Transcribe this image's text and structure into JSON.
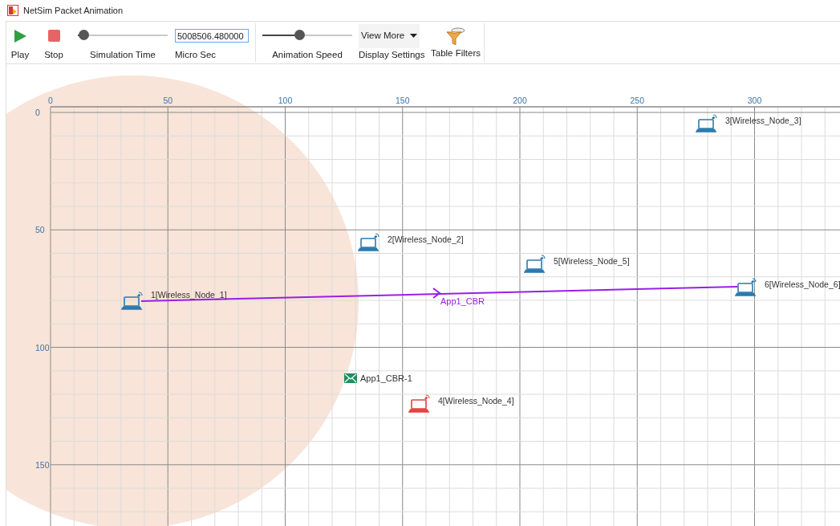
{
  "window": {
    "title": "NetSim Packet Animation"
  },
  "toolbar": {
    "play": {
      "label": "Play"
    },
    "stop": {
      "label": "Stop"
    },
    "simulation_time": {
      "label": "Simulation Time",
      "level": 0.06
    },
    "time_field": {
      "value": "5008506.480000",
      "label": "Micro Sec"
    },
    "animation_speed": {
      "label": "Animation Speed",
      "level": 0.41
    },
    "display_settings": {
      "button": "View More",
      "label": "Display Settings"
    },
    "table_filters": {
      "label": "Table Filters"
    }
  },
  "canvas": {
    "x_ticks": [
      "0",
      "50",
      "100",
      "150",
      "200",
      "250",
      "300"
    ],
    "y_ticks": [
      "0",
      "50",
      "100",
      "150"
    ],
    "nodes": [
      {
        "label": "3[Wireless_Node_3]",
        "color": "#2a7bb0"
      },
      {
        "label": "2[Wireless_Node_2]",
        "color": "#2a7bb0"
      },
      {
        "label": "5[Wireless_Node_5]",
        "color": "#2a7bb0"
      },
      {
        "label": "6[Wireless_Node_6]",
        "color": "#2a7bb0"
      },
      {
        "label": "1[Wireless_Node_1]",
        "color": "#2a7bb0"
      },
      {
        "label": "4[Wireless_Node_4]",
        "color": "#e8413c"
      }
    ],
    "flow": {
      "label": "App1_CBR"
    },
    "packet": {
      "label": "App1_CBR-1"
    }
  }
}
